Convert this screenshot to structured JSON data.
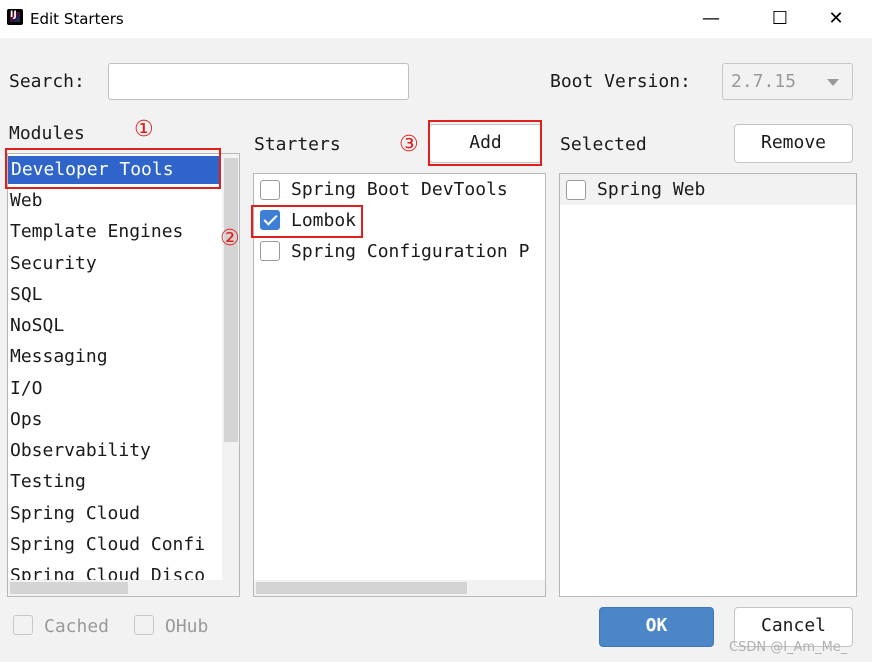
{
  "window": {
    "title": "Edit Starters",
    "minimize_glyph": "—",
    "maximize_glyph": "☐",
    "close_glyph": "✕"
  },
  "search": {
    "label": "Search:",
    "value": ""
  },
  "boot_version": {
    "label": "Boot Version:",
    "value": "2.7.15"
  },
  "modules": {
    "label": "Modules",
    "items": [
      "Developer Tools",
      "Web",
      "Template Engines",
      "Security",
      "SQL",
      "NoSQL",
      "Messaging",
      "I/O",
      "Ops",
      "Observability",
      "Testing",
      "Spring Cloud",
      "Spring Cloud Confi",
      "Spring Cloud Disco"
    ],
    "selected": "Developer Tools"
  },
  "starters": {
    "label": "Starters",
    "add_label": "Add",
    "items": [
      {
        "label": "Spring Boot DevTools",
        "checked": false
      },
      {
        "label": "Lombok",
        "checked": true
      },
      {
        "label": "Spring Configuration P",
        "checked": false
      }
    ]
  },
  "selected": {
    "label": "Selected",
    "remove_label": "Remove",
    "items": [
      {
        "label": "Spring Web",
        "checked": false
      }
    ]
  },
  "footer": {
    "cached_label": "Cached",
    "ohub_label": "OHub",
    "ok_label": "OK",
    "cancel_label": "Cancel"
  },
  "annotations": {
    "step1": "①",
    "step2": "②",
    "step3": "③",
    "color": "#e0201e"
  },
  "watermark": "CSDN @I_Am_Me_"
}
